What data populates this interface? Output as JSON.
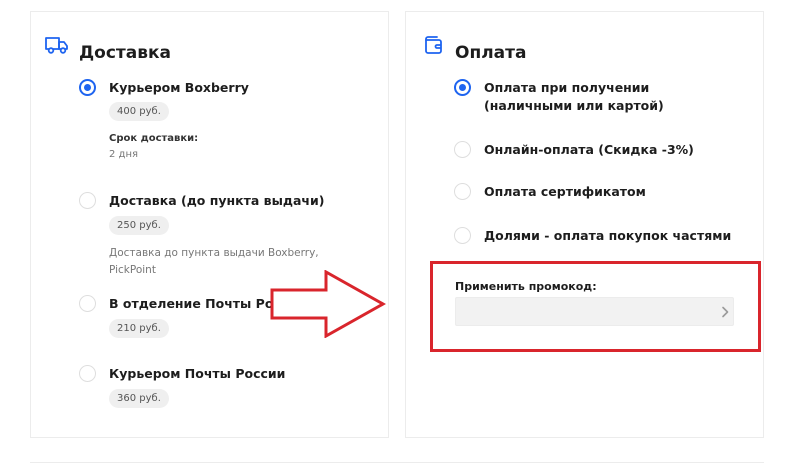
{
  "delivery": {
    "title": "Доставка",
    "icon": "truck-icon",
    "options": [
      {
        "label": "Курьером Boxberry",
        "price": "400 руб.",
        "checked": true,
        "meta_label": "Срок доставки:",
        "meta_value": "2 дня"
      },
      {
        "label": "Доставка (до пункта выдачи)",
        "price": "250 руб.",
        "checked": false,
        "description": "Доставка до пункта выдачи Boxberry, PickPoint"
      },
      {
        "label": "В отделение Почты России",
        "price": "210 руб.",
        "checked": false
      },
      {
        "label": "Курьером Почты России",
        "price": "360 руб.",
        "checked": false
      }
    ]
  },
  "payment": {
    "title": "Оплата",
    "icon": "wallet-icon",
    "options": [
      {
        "label": "Оплата при получении (наличными или картой)",
        "checked": true
      },
      {
        "label": "Онлайн-оплата (Скидка -3%)",
        "checked": false
      },
      {
        "label": "Оплата сертификатом",
        "checked": false
      },
      {
        "label": "Долями - оплата покупок частями",
        "checked": false
      }
    ]
  },
  "promo": {
    "label": "Применить промокод:",
    "value": "",
    "submit_icon": "chevron-right-icon"
  },
  "annotation": {
    "arrow_icon": "arrow-right-icon",
    "highlight_color": "#d9252c"
  },
  "colors": {
    "accent": "#1e64f0",
    "highlight": "#d9252c"
  }
}
